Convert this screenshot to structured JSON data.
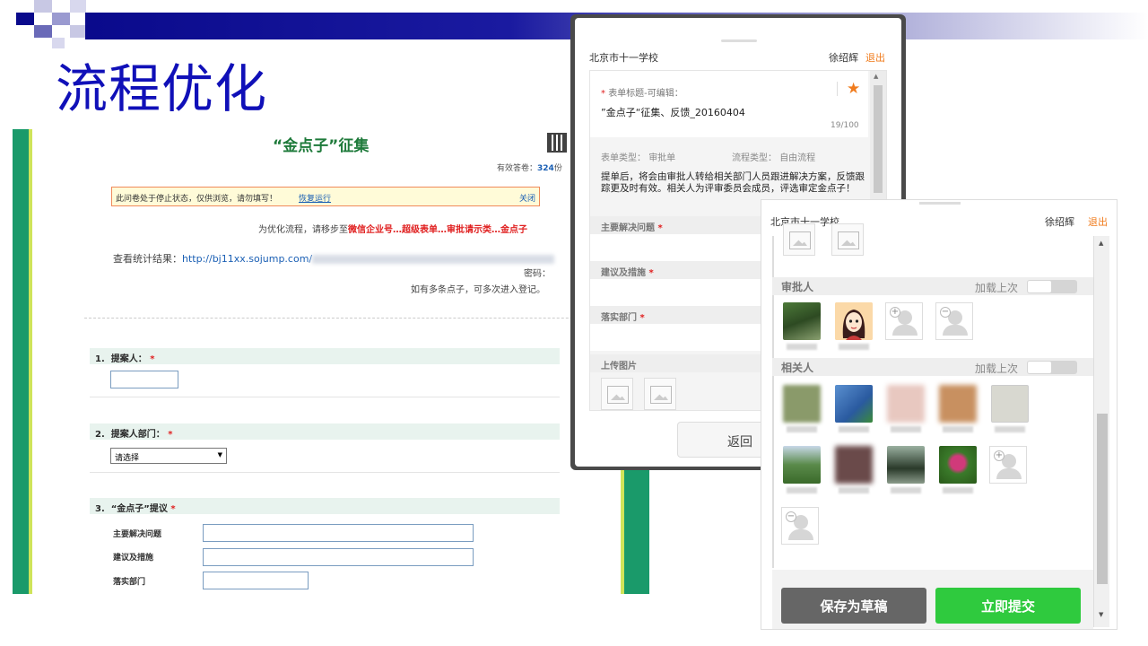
{
  "slide": {
    "title": "流程优化",
    "colors": {
      "title": "#1010b8",
      "band": "#0a0a8c",
      "accent_green": "#1a9a6a",
      "orange": "#f07c1e",
      "submit_green": "#2fca3e"
    }
  },
  "form": {
    "title": "“金点子”征集",
    "valid_answers_label": "有效答卷：",
    "valid_answers_count": "324",
    "valid_answers_unit": "份",
    "notice": {
      "text": "此问卷处于停止状态，仅供浏览，请勿填写！",
      "restore_label": "恢复运行",
      "close_label": "关闭"
    },
    "move_prefix": "为优化流程，请移步至",
    "move_path": "微信企业号…超级表单…审批请示类…金点子",
    "stats_prefix": "查看统计结果：",
    "stats_url": "http://bj11xx.sojump.com/",
    "password_label": "密码：",
    "multi_note": "如有多条点子，可多次进入登记。",
    "questions": [
      {
        "num": "1.",
        "label": "提案人：",
        "required": "*"
      },
      {
        "num": "2.",
        "label": "提案人部门：",
        "required": "*"
      },
      {
        "num": "3.",
        "label": "“金点子”提议",
        "required": "*"
      }
    ],
    "dept_select_value": "请选择",
    "sub_fields": [
      "主要解决问题",
      "建议及措施",
      "落实部门"
    ]
  },
  "mobile_form": {
    "school": "北京市十一学校",
    "user": "徐绍辉",
    "exit_label": "退出",
    "title_label": "表单标题-可编辑：",
    "title_required": "*",
    "title_value": "”金点子“征集、反馈_20160404",
    "title_count": "19/100",
    "form_type_label": "表单类型：",
    "form_type_value": "审批单",
    "flow_type_label": "流程类型：",
    "flow_type_value": "自由流程",
    "description": "提单后，将会由审批人转给相关部门人员跟进解决方案，反馈跟踪更及时有效。相关人为评审委员会成员，评选审定金点子！",
    "sections": [
      {
        "label": "主要解决问题",
        "required": "*"
      },
      {
        "label": "建议及措施",
        "required": "*"
      },
      {
        "label": "落实部门",
        "required": "*"
      },
      {
        "label": "上传图片",
        "required": ""
      }
    ],
    "back_label": "返回"
  },
  "mobile_approve": {
    "school": "北京市十一学校",
    "user": "徐绍辉",
    "exit_label": "退出",
    "approver_label": "审批人",
    "related_label": "相关人",
    "load_last_label": "加载上次",
    "save_draft_label": "保存为草稿",
    "submit_label": "立即提交"
  }
}
